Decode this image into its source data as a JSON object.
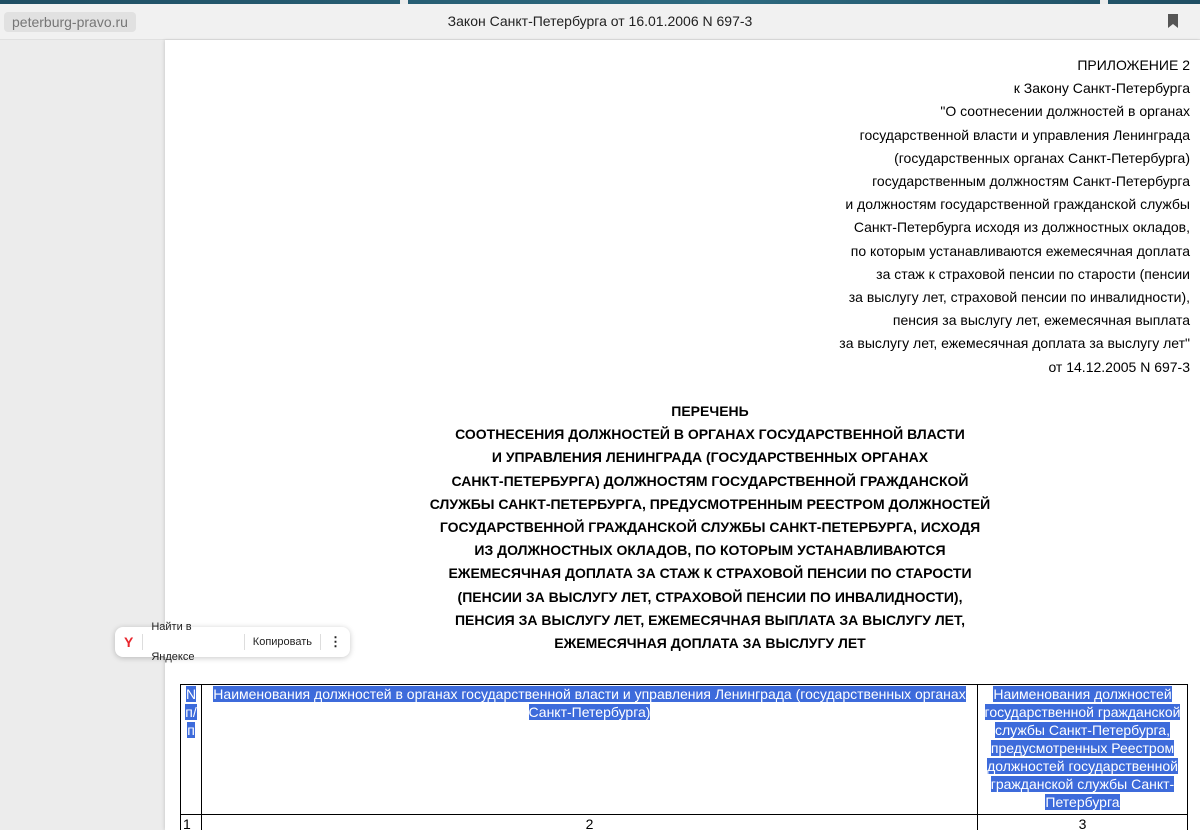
{
  "browser": {
    "domain": "peterburg-pravo.ru",
    "title": "Закон Санкт-Петербурга от 16.01.2006 N 697-3"
  },
  "appendix": {
    "lines": [
      "ПРИЛОЖЕНИЕ 2",
      "к Закону Санкт-Петербурга",
      "\"О соотнесении должностей в органах",
      "государственной власти и управления Ленинграда",
      "(государственных органах Санкт-Петербурга)",
      "государственным должностям Санкт-Петербурга",
      "и должностям государственной гражданской службы",
      "Санкт-Петербурга исходя из должностных окладов,",
      "по которым устанавливаются ежемесячная доплата",
      "за стаж к страховой пенсии по старости (пенсии",
      "за выслугу лет, страховой пенсии по инвалидности),",
      "пенсия за выслугу лет, ежемесячная выплата",
      "за выслугу лет, ежемесячная доплата за выслугу лет\"",
      "от 14.12.2005 N 697-3"
    ]
  },
  "heading": {
    "lines": [
      "ПЕРЕЧЕНЬ",
      "СООТНЕСЕНИЯ ДОЛЖНОСТЕЙ В ОРГАНАХ ГОСУДАРСТВЕННОЙ ВЛАСТИ",
      "И УПРАВЛЕНИЯ ЛЕНИНГРАДА (ГОСУДАРСТВЕННЫХ ОРГАНАХ",
      "САНКТ-ПЕТЕРБУРГА) ДОЛЖНОСТЯМ ГОСУДАРСТВЕННОЙ ГРАЖДАНСКОЙ",
      "СЛУЖБЫ САНКТ-ПЕТЕРБУРГА, ПРЕДУСМОТРЕННЫМ РЕЕСТРОМ ДОЛЖНОСТЕЙ",
      "ГОСУДАРСТВЕННОЙ ГРАЖДАНСКОЙ СЛУЖБЫ САНКТ-ПЕТЕРБУРГА, ИСХОДЯ",
      "ИЗ ДОЛЖНОСТНЫХ ОКЛАДОВ, ПО КОТОРЫМ УСТАНАВЛИВАЮТСЯ",
      "ЕЖЕМЕСЯЧНАЯ ДОПЛАТА ЗА СТАЖ К СТРАХОВОЙ ПЕНСИИ ПО СТАРОСТИ",
      "(ПЕНСИИ ЗА ВЫСЛУГУ ЛЕТ, СТРАХОВОЙ ПЕНСИИ ПО ИНВАЛИДНОСТИ),",
      "ПЕНСИЯ ЗА ВЫСЛУГУ ЛЕТ, ЕЖЕМЕСЯЧНАЯ ВЫПЛАТА ЗА ВЫСЛУГУ ЛЕТ,",
      "ЕЖЕМЕСЯЧНАЯ ДОПЛАТА ЗА ВЫСЛУГУ ЛЕТ"
    ]
  },
  "popup": {
    "logo": "Y",
    "search_label": "Найти в Яндексе",
    "copy_label": "Копировать",
    "more_label": "⋮"
  },
  "table": {
    "headers": [
      "N п/п",
      "Наименования должностей в органах государственной власти и управления Ленинграда (государственных органах Санкт-Петербурга)",
      "Наименования должностей государственной гражданской службы Санкт-Петербурга, предусмотренных Реестром должностей государственной гражданской службы Санкт-Петербурга"
    ],
    "numbers": [
      "1",
      "2",
      "3"
    ]
  },
  "colors": {
    "selection": "#3d6bdb",
    "yandex_red": "#e8262d",
    "accent_bar": "#2d6a80"
  }
}
